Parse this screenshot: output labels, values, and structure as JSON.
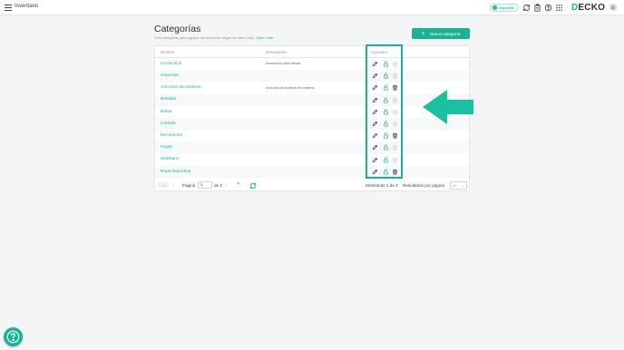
{
  "topbar": {
    "app_title": "Inventario",
    "status_label": "Disponible",
    "brand_first_letter": "D",
    "brand_rest": "ECKO",
    "avatar_initial": "E",
    "icons": [
      "menu-icon",
      "sync-icon",
      "clipboard-icon",
      "help-circle-icon",
      "apps-grid-icon"
    ]
  },
  "page": {
    "title": "Categorías",
    "subtitle": "Crea categorías para agrupar tus productos según su clase o tipo.",
    "learn_more": "Saber más.",
    "new_button": "Nueva categoría"
  },
  "table": {
    "columns": [
      "Nombre",
      "Descripción",
      "Acciones"
    ],
    "rows": [
      {
        "name": "Accesorios",
        "description": "Accesorios para damas",
        "can_delete": false
      },
      {
        "name": "Anuncios",
        "description": "",
        "can_delete": false
      },
      {
        "name": "Artículos decorativos",
        "description": "Artículos decorativos de madera",
        "can_delete": true
      },
      {
        "name": "Bebidas",
        "description": "",
        "can_delete": false
      },
      {
        "name": "Botas",
        "description": "",
        "can_delete": false
      },
      {
        "name": "Comida",
        "description": "",
        "can_delete": false
      },
      {
        "name": "Decoración",
        "description": "",
        "can_delete": true
      },
      {
        "name": "Hogar",
        "description": "",
        "can_delete": false
      },
      {
        "name": "Mobiliario",
        "description": "",
        "can_delete": false
      },
      {
        "name": "Ropa Deportiva",
        "description": "",
        "can_delete": true
      }
    ]
  },
  "pagination": {
    "first": "«",
    "prev": "‹",
    "page_label": "Página",
    "current_page": "1",
    "of_label": "de 2",
    "next": "›",
    "last": "»",
    "showing": "Mostrando 1 de 2",
    "per_page_label": "Resultados por página",
    "per_page_value": "10"
  },
  "colors": {
    "accent": "#19b394",
    "text_dark": "#2b2f33",
    "muted": "#8a8f96",
    "background": "#f4f5f6"
  }
}
